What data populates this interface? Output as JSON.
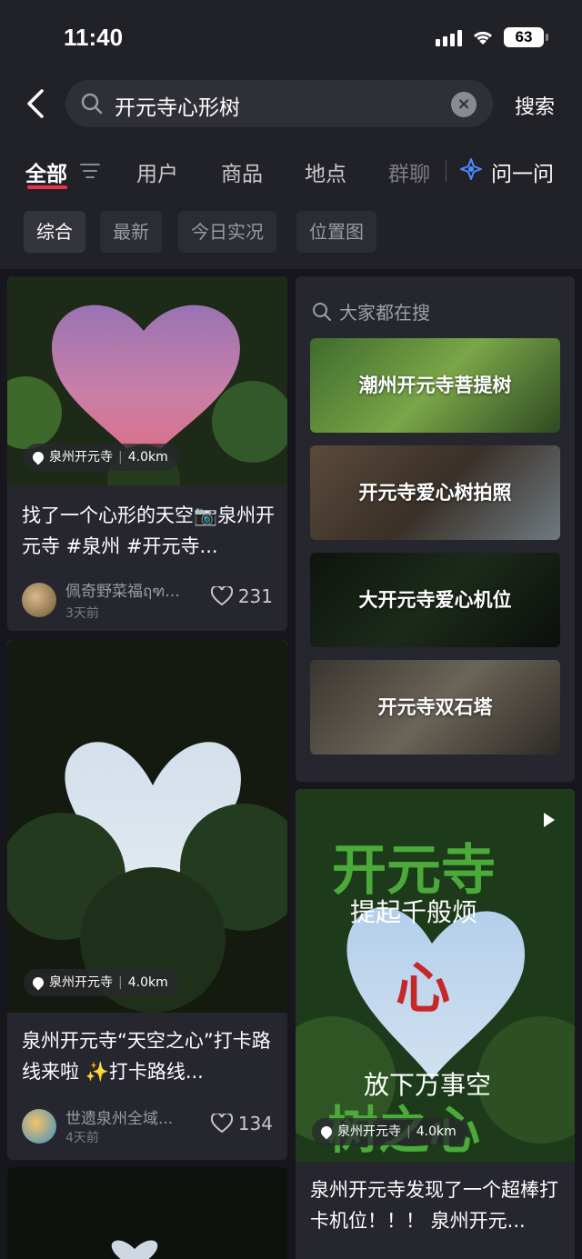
{
  "status": {
    "time": "11:40",
    "battery": "63"
  },
  "search": {
    "query": "开元寺心形树",
    "button": "搜索"
  },
  "tabs": [
    {
      "label": "全部"
    },
    {
      "label": "用户"
    },
    {
      "label": "商品"
    },
    {
      "label": "地点"
    },
    {
      "label": "群聊"
    },
    {
      "label": "问一问"
    }
  ],
  "chips": [
    "综合",
    "最新",
    "今日实况",
    "位置图"
  ],
  "hot": {
    "title": "大家都在搜",
    "items": [
      "潮州开元寺菩提树",
      "开元寺爱心树拍照",
      "大开元寺爱心机位",
      "开元寺双石塔"
    ]
  },
  "cards": [
    {
      "location": "泉州开元寺",
      "distance": "4.0km",
      "title": "找了一个心形的天空📷泉州开元寺 #泉州 #开元寺...",
      "author": "佩奇野菜福ฤฑ...",
      "time": "3天前",
      "likes": "231"
    },
    {
      "location": "泉州开元寺",
      "distance": "4.0km",
      "title": "泉州开元寺“天空之心”打卡路线来啦 ✨打卡路线...",
      "author": "世遗泉州全域...",
      "time": "4天前",
      "likes": "134"
    },
    {
      "location": "泉州开元寺",
      "distance": "4.0km",
      "title": "泉州开元寺发现了一个超棒打卡机位！！！ 泉州开元...",
      "overlay": [
        "开元寺",
        "提起千般烦",
        "心",
        "放下万事空",
        "树之心"
      ]
    }
  ],
  "colors": {
    "accent": "#f0304a",
    "bg": "#16161c",
    "card": "#26262e"
  }
}
